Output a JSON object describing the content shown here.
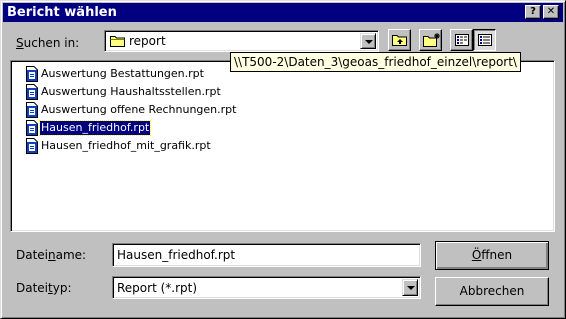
{
  "window": {
    "title": "Bericht wählen",
    "help_label": "?",
    "close_label": "✕"
  },
  "lookin": {
    "label_pre": "",
    "label_ul": "S",
    "label_post": "uchen in:",
    "value": "report",
    "tooltip": "\\\\T500-2\\Daten_3\\geoas_friedhof_einzel\\report\\"
  },
  "toolbar": [
    {
      "name": "up-one-level-button",
      "icon": "folder-up-icon"
    },
    {
      "name": "new-folder-button",
      "icon": "new-folder-icon"
    },
    {
      "name": "list-view-button",
      "icon": "list-view-icon"
    },
    {
      "name": "details-view-button",
      "icon": "details-view-icon"
    }
  ],
  "files": [
    {
      "name": "Auswertung Bestattungen.rpt",
      "selected": false
    },
    {
      "name": "Auswertung Haushaltsstellen.rpt",
      "selected": false
    },
    {
      "name": "Auswertung offene Rechnungen.rpt",
      "selected": false
    },
    {
      "name": "Hausen_friedhof.rpt",
      "selected": true
    },
    {
      "name": "Hausen_friedhof_mit_grafik.rpt",
      "selected": false
    }
  ],
  "filename": {
    "label_pre": "Datei",
    "label_ul": "n",
    "label_post": "ame:",
    "value": "Hausen_friedhof.rpt"
  },
  "filetype": {
    "label_pre": "Datei",
    "label_ul": "t",
    "label_post": "yp:",
    "value": "Report (*.rpt)"
  },
  "buttons": {
    "open_ul": "Ö",
    "open_post": "ffnen",
    "cancel": "Abbrechen"
  },
  "colors": {
    "title_bar": "#000080",
    "face": "#c0c0c0",
    "selection": "#000080",
    "tooltip_bg": "#ffffe1"
  }
}
